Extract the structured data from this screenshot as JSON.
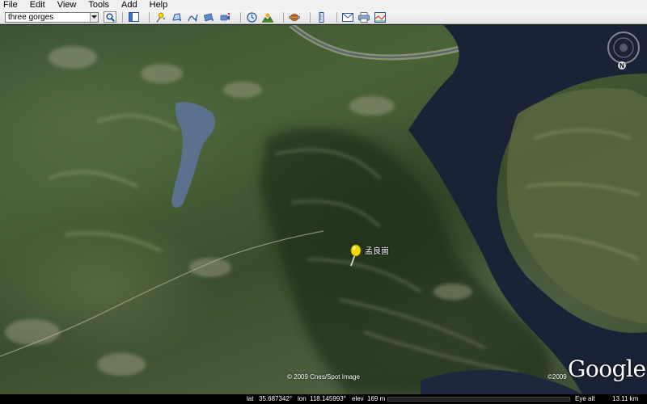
{
  "menu": {
    "items": [
      "File",
      "Edit",
      "View",
      "Tools",
      "Add",
      "Help"
    ]
  },
  "search": {
    "value": "three gorges"
  },
  "icons": {
    "dropdown": "chevron-down-icon",
    "search": "magnifier-icon",
    "toolbar": [
      "sidebar-toggle-icon",
      "placemark-icon",
      "polygon-icon",
      "path-icon",
      "image-overlay-icon",
      "tour-icon",
      "historical-imagery-icon",
      "sunlight-icon",
      "planet-icon",
      "ruler-icon",
      "email-icon",
      "print-icon",
      "maps-icon"
    ],
    "pin": "pushpin-icon",
    "compass": "compass-icon"
  },
  "map": {
    "placemark_label": "孟良崮",
    "imagery_credit": "© 2009 Cnes/Spot Image",
    "logo_copyright": "©2009",
    "logo_text": "Google",
    "compass_label": "N"
  },
  "status": {
    "lat_label": "lat",
    "lat_value": "35.687342°",
    "lon_label": "lon",
    "lon_value": "118.145993°",
    "elev_label": "elev",
    "elev_value": "169 m",
    "eye_alt_label": "Eye alt",
    "eye_alt_value": "13.11 km",
    "streaming_progress": 0
  },
  "colors": {
    "water": "#1a2336",
    "reservoir": "#5a7391",
    "pin": "#f2d800"
  }
}
